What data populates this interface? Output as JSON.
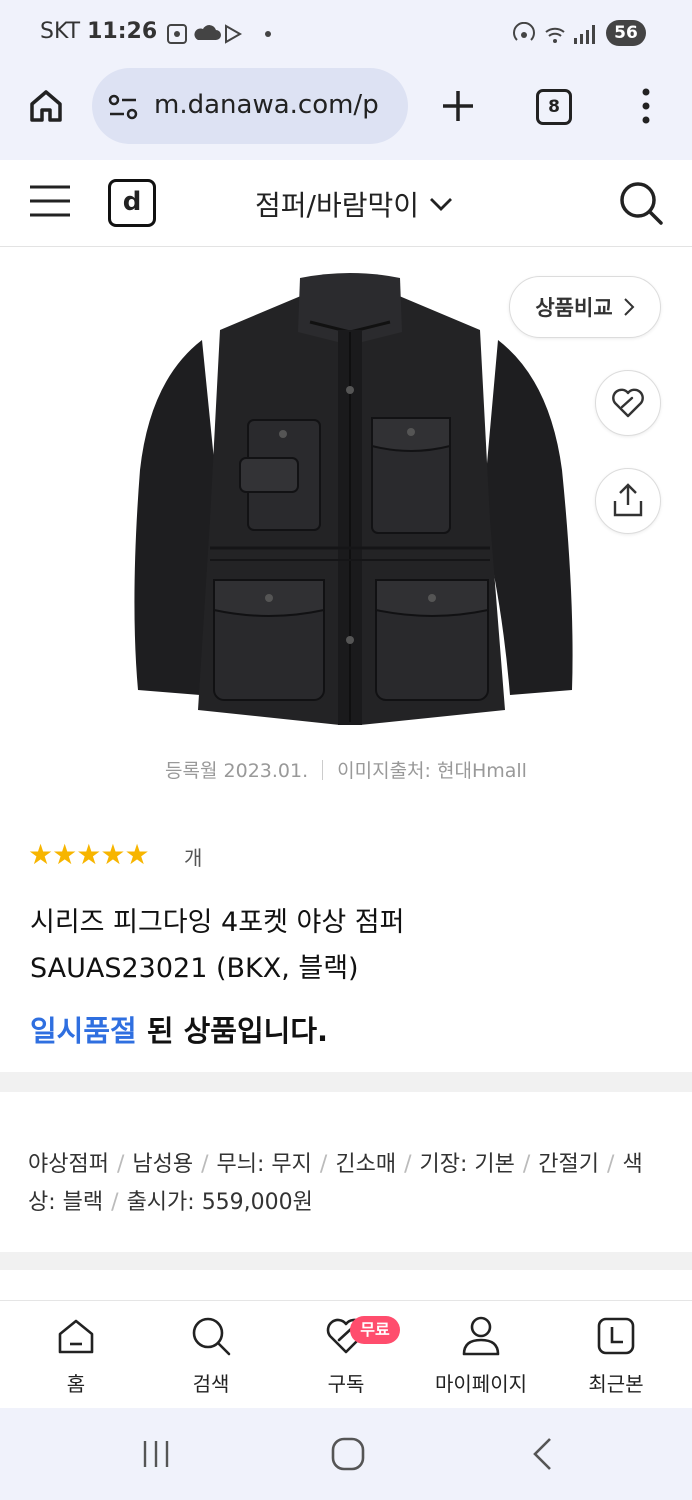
{
  "status_bar": {
    "carrier": "SKT",
    "time": "11:26",
    "battery": "56"
  },
  "browser": {
    "url": "m.danawa.com/p",
    "tab_count": "8"
  },
  "site_header": {
    "logo": "d",
    "category": "점퍼/바람막이"
  },
  "product": {
    "compare_label": "상품비교",
    "reg_date": "등록월 2023.01.",
    "image_source": "이미지출처: 현대Hmall",
    "rating_stars": 5,
    "rating_label": "개",
    "title_line1": "시리즈 피그다잉 4포켓 야상 점퍼",
    "title_line2": "SAUAS23021 (BKX, 블랙)",
    "soldout_highlight": "일시품절",
    "soldout_rest": " 된 상품입니다.",
    "specs": [
      "야상점퍼",
      "남성용",
      "무늬: 무지",
      "긴소매",
      "기장: 기본",
      "간절기",
      "색상: 블랙",
      "출시가: 559,000원"
    ]
  },
  "bottom_nav": {
    "items": [
      {
        "label": "홈",
        "icon": "home-icon"
      },
      {
        "label": "검색",
        "icon": "search-icon"
      },
      {
        "label": "구독",
        "icon": "heart-icon"
      },
      {
        "label": "마이페이지",
        "icon": "user-icon"
      },
      {
        "label": "최근본",
        "icon": "clock-icon"
      }
    ],
    "badge": "무료"
  },
  "colors": {
    "accent_blue": "#2f6fe0",
    "star": "#f7b500",
    "badge": "#ff4d6d"
  }
}
